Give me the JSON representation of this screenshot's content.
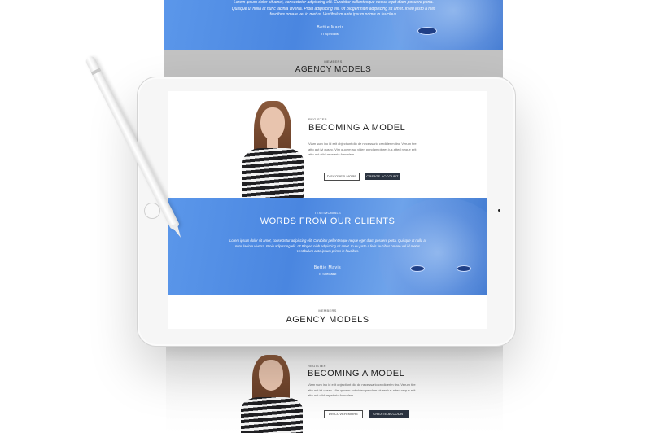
{
  "top_strip": {
    "paragraph": "Lorem ipsum dolor sit amet, consectetur adipiscing elit. Curabitur pellentesque neque eget diam posuere porta. Quisque ut nulla at nunc lacinia viverra. Proin adipiscing elit. Ut Blogert nibh adipiscing sit amet. In eu justo a felis faucibus ornare vel id metus. Vestibulum ante ipsum primis in faucibus.",
    "author": "Bettie Mavis",
    "role": "IT Specialist",
    "members_label": "MEMBERS",
    "agency_title": "AGENCY MODELS"
  },
  "screen": {
    "register_label": "REGISTER",
    "register_title": "BECOMING A MODEL",
    "register_text": "Viam sum ino id erit objectiunt dio de necessario crediderim tiro. Verum tire atto aut ivi qusec. Vim quoem aut viden pendam plures ius atted neque erit atto aut nihil repeterio formalem.",
    "discover_button": "DISCOVER MORE",
    "create_button": "CREATE ACCOUNT",
    "testimonials_label": "TESTIMONIALS",
    "testimonials_title": "WORDS FROM OUR CLIENTS",
    "testimonial_text": "Lorem ipsum dolor sit amet, consectetur adipiscing elit. Curabitur pellentesque neque eget diam posuere porta. Quisque ut nulla at nunc lacinia viverra. Proin adipiscing elit. Ut Blogert nibh adipiscing sit amet. In eu justo a felis faucibus ornare vel id metus. Vestibulum ante ipsum primis in faucibus.",
    "testimonial_author": "Bettie Mavis",
    "testimonial_role": "IT Specialist",
    "members_label": "MEMBERS",
    "agency_title": "AGENCY MODELS"
  },
  "bottom_strip": {
    "register_label": "REGISTER",
    "register_title": "BECOMING A MODEL",
    "register_text": "Viam sum ino id erit objectiunt dio de necessario crediderim tiro. Verum tire atto aut ivi qusec. Vim quoem aut viden pendam plures ius atted neque erit atto aut nihil repeterio formalem.",
    "discover_button": "DISCOVER MORE",
    "create_button": "CREATE ACCOUNT"
  },
  "colors": {
    "accent_blue": "#4a86e0",
    "dark_button": "#2b3340"
  }
}
